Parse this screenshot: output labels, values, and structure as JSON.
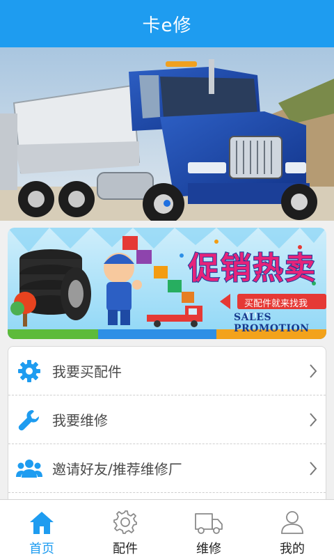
{
  "app": {
    "title": "卡e修"
  },
  "banner": {
    "slides": 1,
    "active_slide": 1
  },
  "promo": {
    "headline": "促销热卖",
    "tagline": "买配件就来找我们！",
    "subtitle": "SALES PROMOTION"
  },
  "menu": {
    "items": [
      {
        "label": "我要买配件",
        "icon": "gear-icon"
      },
      {
        "label": "我要维修",
        "icon": "wrench-icon"
      },
      {
        "label": "邀请好友/推荐维修厂",
        "icon": "users-icon"
      }
    ]
  },
  "tabs": [
    {
      "label": "首页",
      "icon": "home-icon",
      "active": true
    },
    {
      "label": "配件",
      "icon": "gear-icon",
      "active": false
    },
    {
      "label": "维修",
      "icon": "truck-icon",
      "active": false
    },
    {
      "label": "我的",
      "icon": "person-icon",
      "active": false
    }
  ],
  "colors": {
    "primary": "#1e9cf0",
    "text": "#4a4a4a",
    "accent": "#e6237a"
  }
}
